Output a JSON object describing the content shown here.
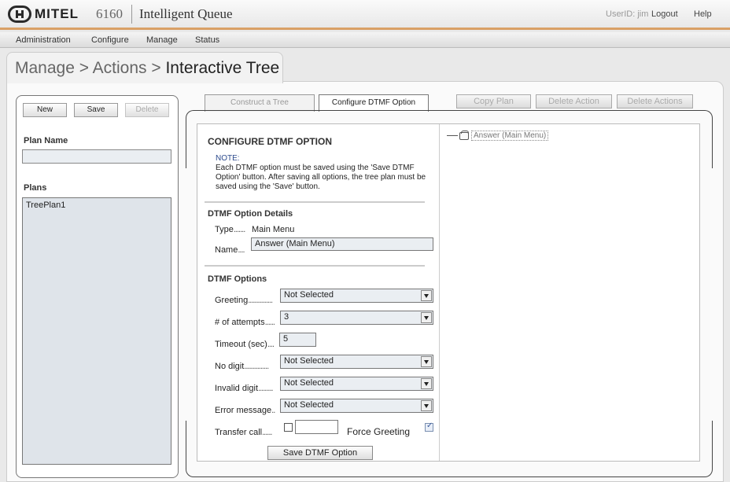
{
  "header": {
    "brand": "MITEL",
    "product_number": "6160",
    "product_name": "Intelligent Queue",
    "user_id": "UserID: jim",
    "logout": "Logout",
    "help": "Help"
  },
  "nav": [
    "Administration",
    "Configure",
    "Manage",
    "Status"
  ],
  "breadcrumb": {
    "prefix": "Manage > Actions > ",
    "current": "Interactive Tree"
  },
  "left_panel": {
    "buttons": {
      "new": "New",
      "save": "Save",
      "delete": "Delete"
    },
    "plan_name_label": "Plan Name",
    "plan_name_value": "",
    "plans_label": "Plans",
    "plans": [
      "TreePlan1"
    ]
  },
  "tabs": {
    "construct": "Construct a Tree",
    "configure": "Configure DTMF Option"
  },
  "actions": {
    "copy_plan": "Copy Plan",
    "delete_action": "Delete Action",
    "delete_actions": "Delete Actions"
  },
  "form": {
    "title": "CONFIGURE DTMF OPTION",
    "note_head": "NOTE:",
    "note_body": "Each DTMF option must be saved using the 'Save DTMF Option' button. After saving all options, the tree plan must be saved using the 'Save' button.",
    "details_title": "DTMF Option Details",
    "type_label": "Type",
    "type_value": "Main Menu",
    "name_label": "Name",
    "name_value": "Answer (Main Menu)",
    "options_title": "DTMF Options",
    "greeting_label": "Greeting",
    "greeting_value": "Not Selected",
    "attempts_label": "# of attempts",
    "attempts_value": "3",
    "timeout_label": "Timeout (sec)",
    "timeout_value": "5",
    "nodigit_label": "No digit",
    "nodigit_value": "Not Selected",
    "invalid_label": "Invalid digit",
    "invalid_value": "Not Selected",
    "error_label": "Error message",
    "error_value": "Not Selected",
    "transfer_label": "Transfer call",
    "transfer_checked": false,
    "transfer_value": "",
    "force_greeting_label": "Force Greeting",
    "force_greeting_checked": true,
    "save_label": "Save DTMF Option"
  },
  "tree": {
    "node_label": "Answer (Main Menu)",
    "node_icon": "phone-icon"
  }
}
